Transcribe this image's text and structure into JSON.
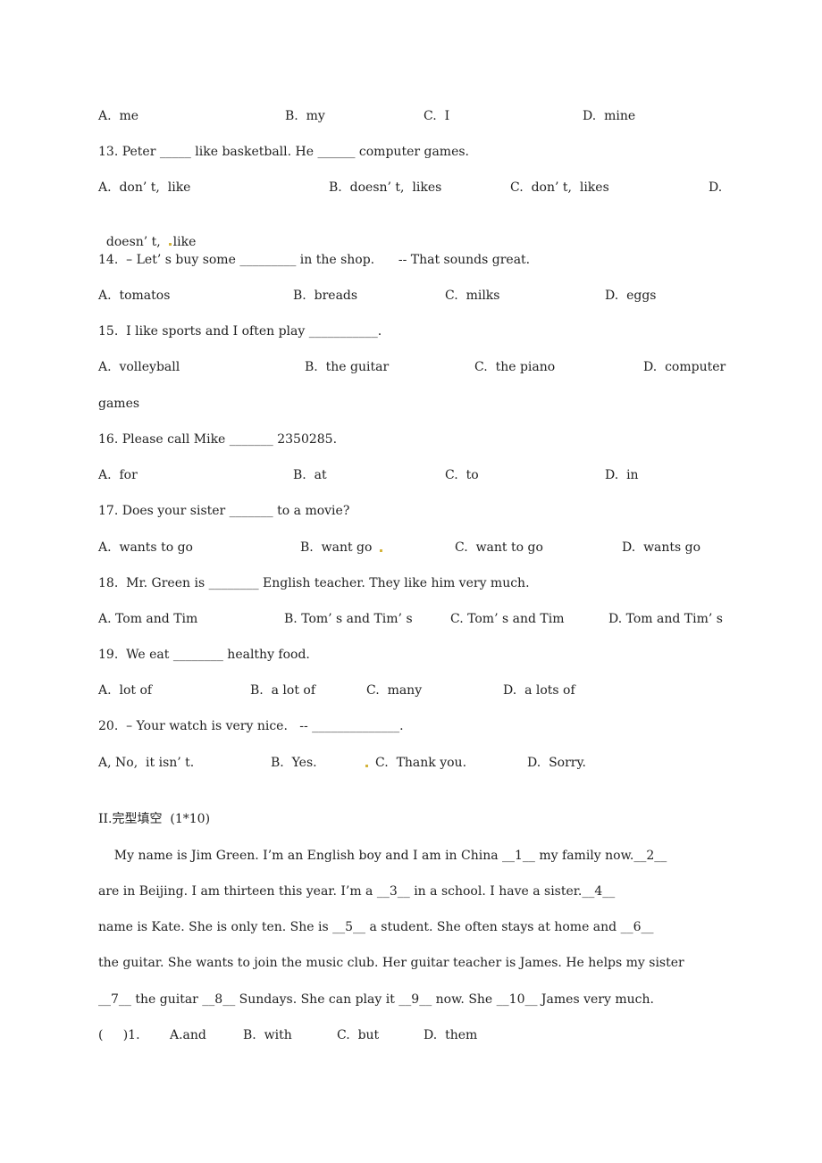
{
  "q12_options": {
    "a": "A.  me",
    "b": "B.  my",
    "c": "C.  I",
    "d": "D.  mine"
  },
  "q13": {
    "stem": "13. Peter _____ like basketball. He ______ computer games.",
    "a": "A.  don’ t,  like",
    "b": "B.  doesn’ t,  likes",
    "c": "C.  don’ t,  likes",
    "d_label": "D.",
    "d_wrap_pre": "doesn’ t,  ",
    "d_wrap_post": "like"
  },
  "q14": {
    "stem": "14.  – Let’ s buy some _________ in the shop.      -- That sounds great.",
    "a": "A.  tomatos",
    "b": "B.  breads",
    "c": "C.  milks",
    "d": "D.  eggs"
  },
  "q15": {
    "stem": "15.  I like sports and I often play ___________.",
    "a": "A.  volleyball",
    "b": "B.  the guitar",
    "c": "C.  the piano",
    "d": "D.  computer",
    "d_wrap": "games"
  },
  "q16": {
    "stem": "16. Please call Mike _______ 2350285.",
    "a": "A.  for",
    "b": "B.  at",
    "c": "C.  to",
    "d": "D.  in"
  },
  "q17": {
    "stem": "17. Does your sister _______ to a movie?",
    "a": "A.  wants to go",
    "b": "B.  want go",
    "c": "C.  want to go",
    "d": "D.  wants go"
  },
  "q18": {
    "stem": "18.  Mr. Green is ________ English teacher. They like him very much.",
    "a": "A. Tom and Tim",
    "b": "B. Tom’ s and Tim’ s",
    "c": "C. Tom’ s and Tim",
    "d": "D. Tom and Tim’ s"
  },
  "q19": {
    "stem": "19.  We eat ________ healthy food.",
    "a": "A.  lot of",
    "b": "B.  a lot of",
    "c": "C.  many",
    "d": "D.  a lots of"
  },
  "q20": {
    "stem": "20.  – Your watch is very nice.   -- ______________.",
    "a": "A, No,  it isn’ t.",
    "b": "B.  Yes.",
    "c": "C.  Thank you.",
    "d": "D.  Sorry."
  },
  "section2": {
    "title": "II.完型填空  (1*10)",
    "lines": [
      "    My name is Jim Green. I’m an English boy and I am in China __1__ my family now.__2__",
      "are in Beijing. I am thirteen this year. I’m a __3__ in a school. I have a sister.__4__",
      "name is Kate. She is only ten. She is __5__ a student. She often stays at home and __6__",
      "the guitar. She wants to join the music club. Her guitar teacher is James. He helps my sister",
      "__7__ the guitar __8__ Sundays. She can play it __9__ now. She __10__ James very much."
    ],
    "q1": {
      "paren": "(     )1.",
      "a": "A.and",
      "b": "B.  with",
      "c": "C.  but",
      "d": "D.  them"
    }
  },
  "colors": {
    "text": "#222222",
    "mark": "#d4b43c"
  }
}
